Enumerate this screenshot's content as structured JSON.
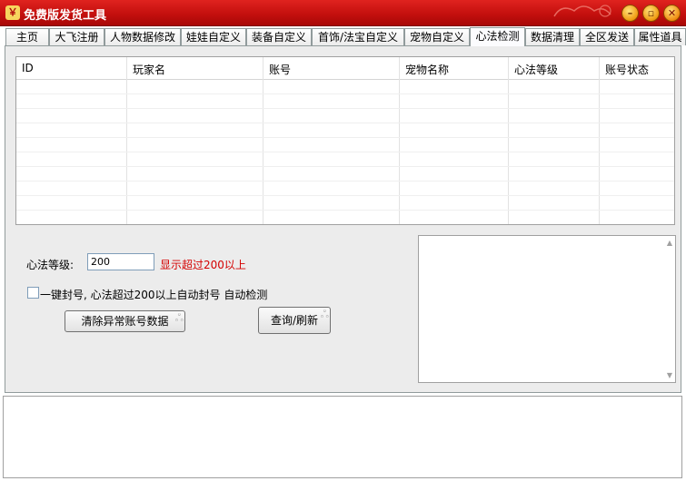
{
  "window": {
    "title": "免费版发货工具",
    "accent": "#c4100e"
  },
  "tabs": [
    {
      "label": "主页"
    },
    {
      "label": "大飞注册"
    },
    {
      "label": "人物数据修改"
    },
    {
      "label": "娃娃自定义"
    },
    {
      "label": "装备自定义"
    },
    {
      "label": "首饰/法宝自定义"
    },
    {
      "label": "宠物自定义"
    },
    {
      "label": "心法检测"
    },
    {
      "label": "数据清理"
    },
    {
      "label": "全区发送"
    },
    {
      "label": "属性道具"
    }
  ],
  "active_tab": "心法检测",
  "table": {
    "columns": [
      "ID",
      "玩家名",
      "账号",
      "宠物名称",
      "心法等级",
      "账号状态"
    ],
    "rows": []
  },
  "form": {
    "level_label": "心法等级:",
    "level_value": "200",
    "hint": "显示超过200以上",
    "hint_color": "#d40000",
    "auto_ban_label": "一键封号, 心法超过200以上自动封号 自动检测",
    "auto_ban_checked": false
  },
  "buttons": {
    "clear_label": "清除异常账号数据",
    "query_label": "查询/刷新"
  }
}
